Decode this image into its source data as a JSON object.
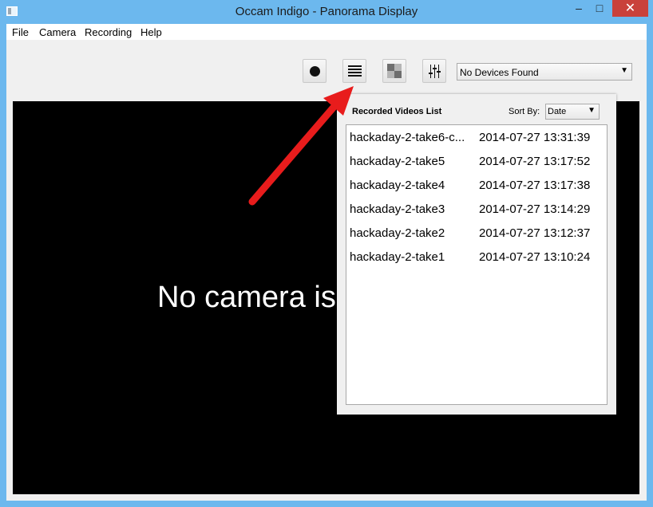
{
  "window": {
    "title": "Occam Indigo - Panorama Display",
    "minimize": "‒",
    "maximize": "□",
    "close": "✕"
  },
  "menu": [
    "File",
    "Camera",
    "Recording",
    "Help"
  ],
  "toolbar": {
    "device_select": {
      "value": "No Devices Found"
    }
  },
  "video": {
    "message": "No camera is"
  },
  "recorded_panel": {
    "title": "Recorded Videos List",
    "sort_label": "Sort By:",
    "sort_value": "Date",
    "videos": [
      {
        "name": "hackaday-2-take6-c...",
        "date": "2014-07-27 13:31:39"
      },
      {
        "name": "hackaday-2-take5",
        "date": "2014-07-27 13:17:52"
      },
      {
        "name": "hackaday-2-take4",
        "date": "2014-07-27 13:17:38"
      },
      {
        "name": "hackaday-2-take3",
        "date": "2014-07-27 13:14:29"
      },
      {
        "name": "hackaday-2-take2",
        "date": "2014-07-27 13:12:37"
      },
      {
        "name": "hackaday-2-take1",
        "date": "2014-07-27 13:10:24"
      }
    ]
  },
  "colors": {
    "accent_arrow": "#e81c1c",
    "title_bar": "#6cb8ee",
    "close_button": "#c9413b"
  }
}
